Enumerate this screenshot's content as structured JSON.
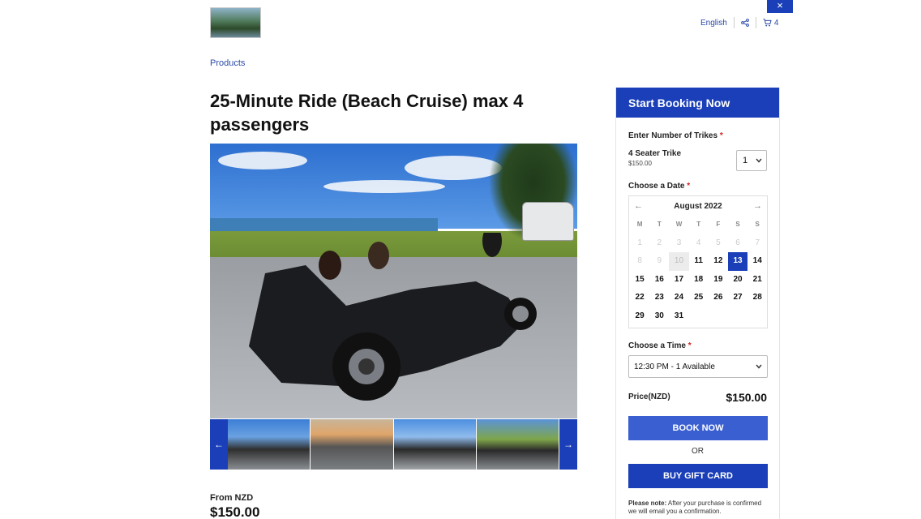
{
  "header": {
    "language": "English",
    "cart_count": "4",
    "close_label": "×"
  },
  "breadcrumb": "Products",
  "product": {
    "title": "25-Minute Ride (Beach Cruise) max 4 passengers",
    "from_label": "From NZD",
    "from_price": "$150.00"
  },
  "gallery": {
    "prev": "←",
    "next": "→"
  },
  "booking": {
    "heading": "Start Booking Now",
    "trikes_label": "Enter Number of Trikes",
    "trike_name": "4 Seater Trike",
    "trike_price": "$150.00",
    "quantity": "1",
    "date_label": "Choose a Date",
    "month": "August 2022",
    "weekdays": [
      "M",
      "T",
      "W",
      "T",
      "F",
      "S",
      "S"
    ],
    "days": [
      {
        "d": "1",
        "s": "dis"
      },
      {
        "d": "2",
        "s": "dis"
      },
      {
        "d": "3",
        "s": "dis"
      },
      {
        "d": "4",
        "s": "dis"
      },
      {
        "d": "5",
        "s": "dis"
      },
      {
        "d": "6",
        "s": "dis"
      },
      {
        "d": "7",
        "s": "dis"
      },
      {
        "d": "8",
        "s": "dis"
      },
      {
        "d": "9",
        "s": "dis"
      },
      {
        "d": "10",
        "s": "today"
      },
      {
        "d": "11",
        "s": "day"
      },
      {
        "d": "12",
        "s": "day"
      },
      {
        "d": "13",
        "s": "sel"
      },
      {
        "d": "14",
        "s": "day"
      },
      {
        "d": "15",
        "s": "day"
      },
      {
        "d": "16",
        "s": "day"
      },
      {
        "d": "17",
        "s": "day"
      },
      {
        "d": "18",
        "s": "day"
      },
      {
        "d": "19",
        "s": "day"
      },
      {
        "d": "20",
        "s": "day"
      },
      {
        "d": "21",
        "s": "day"
      },
      {
        "d": "22",
        "s": "day"
      },
      {
        "d": "23",
        "s": "day"
      },
      {
        "d": "24",
        "s": "day"
      },
      {
        "d": "25",
        "s": "day"
      },
      {
        "d": "26",
        "s": "day"
      },
      {
        "d": "27",
        "s": "day"
      },
      {
        "d": "28",
        "s": "day"
      },
      {
        "d": "29",
        "s": "day"
      },
      {
        "d": "30",
        "s": "day"
      },
      {
        "d": "31",
        "s": "day"
      }
    ],
    "time_label": "Choose a Time",
    "time_value": "12:30 PM - 1 Available",
    "price_label": "Price(NZD)",
    "price_value": "$150.00",
    "book_label": "BOOK NOW",
    "or_label": "OR",
    "gift_label": "BUY GIFT CARD",
    "note_bold": "Please note:",
    "note_text": "After your purchase is confirmed we will email you a confirmation."
  },
  "colors": {
    "brand_blue": "#1a3fb8",
    "book_blue": "#3a5fd0",
    "link_blue": "#2b4aa8"
  }
}
